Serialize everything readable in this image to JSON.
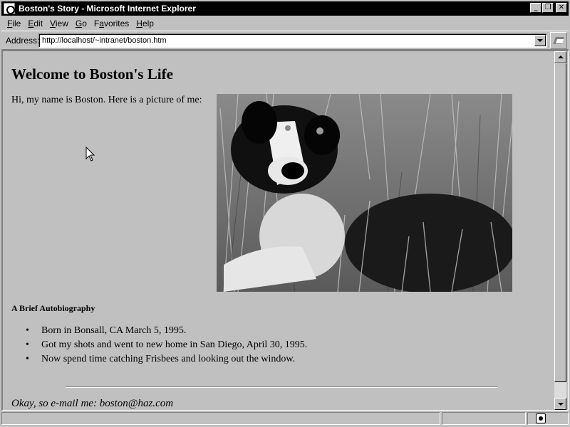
{
  "window": {
    "title": "Boston's Story - Microsoft Internet Explorer",
    "controls": {
      "minimize": "_",
      "restore": "❐",
      "close": "✕"
    }
  },
  "menu": [
    {
      "accel": "F",
      "rest": "ile"
    },
    {
      "accel": "E",
      "rest": "dit"
    },
    {
      "accel": "V",
      "rest": "iew"
    },
    {
      "accel": "G",
      "rest": "o"
    },
    {
      "accel": "",
      "pre": "F",
      "accel2": "a",
      "rest": "vorites"
    },
    {
      "accel": "H",
      "rest": "elp"
    }
  ],
  "address": {
    "label": "Address:",
    "value": "http://localhost/~intranet/boston.htm",
    "icons": {
      "dropdown": "chevron-down-icon",
      "go": "ie-go-icon"
    }
  },
  "page": {
    "heading": "Welcome to Boston's Life",
    "intro": "Hi, my name is Boston. Here is a picture of me:",
    "photo": {
      "subject": "puppy-photo"
    },
    "section_title": "A Brief Autobiography",
    "bio": [
      "Born in Bonsall, CA March 5, 1995.",
      "Got my shots and went to new home in San Diego, April 30, 1995.",
      "Now spend time catching Frisbees and looking out the window."
    ],
    "email_line": "Okay, so e-mail me: boston@haz.com"
  },
  "statusbar": {
    "text": "",
    "zone_icon": "internet-zone-icon"
  },
  "colors": {
    "face": "#c0c0c0",
    "titlebar": "#000000",
    "title_text": "#ffffff"
  }
}
